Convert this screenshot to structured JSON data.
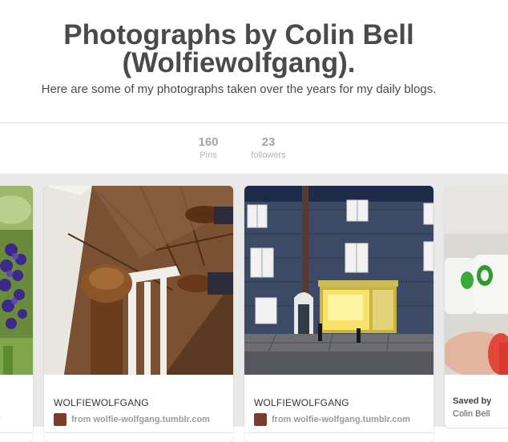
{
  "board": {
    "title_line1": "Photographs by Colin Bell",
    "title_line2": "(Wolfiewolfgang).",
    "description": "Here are some of my photographs taken over the years for my daily blogs."
  },
  "stats": [
    {
      "value": "160",
      "label": "Pins"
    },
    {
      "value": "23",
      "label": "followers"
    }
  ],
  "pins": [
    {
      "user": "WOLFIEWOLFGANG",
      "source": "from wolfie-wolfgang.tumblr.com"
    },
    {
      "user": "WOLFIEWOLFGANG",
      "source": "from wolfie-wolfgang.tumblr.com"
    }
  ],
  "partial_pin": {
    "saved_by_label": "Saved by",
    "saved_by_name": "Colin Bell"
  },
  "left_pin": {
    "source_fragment": "o"
  },
  "colors": {
    "page_bg": "#e9e9e9",
    "title": "#4a4a4a",
    "muted": "#a4a4a4"
  }
}
